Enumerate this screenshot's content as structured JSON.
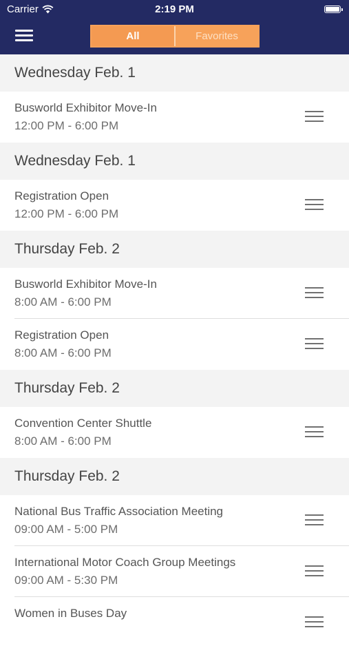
{
  "status_bar": {
    "carrier": "Carrier",
    "time": "2:19 PM"
  },
  "header": {
    "menu_icon": "hamburger-menu-icon",
    "tabs": [
      {
        "label": "All",
        "active": true
      },
      {
        "label": "Favorites",
        "active": false
      }
    ],
    "colors": {
      "nav_bg": "#232a63",
      "accent": "#f7a25a"
    }
  },
  "sections": [
    {
      "date": "Wednesday Feb. 1",
      "events": [
        {
          "title": "Busworld Exhibitor Move-In",
          "time": "12:00 PM - 6:00 PM"
        }
      ]
    },
    {
      "date": "Wednesday Feb. 1",
      "events": [
        {
          "title": "Registration Open",
          "time": "12:00 PM - 6:00 PM"
        }
      ]
    },
    {
      "date": "Thursday Feb. 2",
      "events": [
        {
          "title": "Busworld Exhibitor Move-In",
          "time": "8:00 AM - 6:00 PM"
        },
        {
          "title": "Registration Open",
          "time": "8:00 AM - 6:00 PM"
        }
      ]
    },
    {
      "date": "Thursday Feb. 2",
      "events": [
        {
          "title": "Convention Center Shuttle",
          "time": "8:00 AM - 6:00 PM"
        }
      ]
    },
    {
      "date": "Thursday Feb. 2",
      "events": [
        {
          "title": "National Bus Traffic Association Meeting",
          "time": "09:00 AM - 5:00 PM"
        },
        {
          "title": "International Motor Coach Group Meetings",
          "time": "09:00 AM - 5:30 PM"
        },
        {
          "title": "Women in Buses Day",
          "time": ""
        }
      ]
    }
  ]
}
